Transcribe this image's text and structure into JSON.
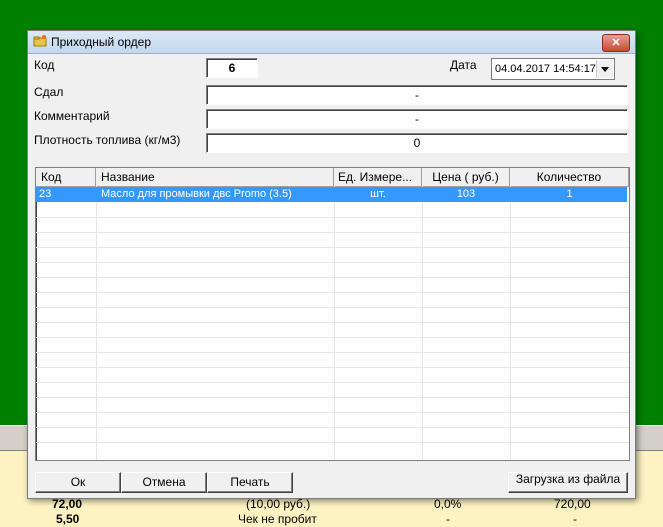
{
  "dialog": {
    "title": "Приходный ордер",
    "close_label": "✕"
  },
  "form": {
    "code_label": "Код",
    "code_value": "6",
    "date_label": "Дата",
    "date_value": "04.04.2017 14:54:17",
    "handed_label": "Сдал",
    "handed_value": "-",
    "comment_label": "Комментарий",
    "comment_value": "-",
    "density_label": "Плотность топлива (кг/м3)",
    "density_value": "0"
  },
  "table": {
    "columns": [
      "Код",
      "Название",
      "Ед. Измере...",
      "Цена ( руб.)",
      "Количество"
    ],
    "rows": [
      {
        "code": "23",
        "name": "Масло для промывки двс Promo (3.5)",
        "unit": "шт.",
        "price": "103",
        "qty": "1"
      }
    ]
  },
  "buttons": {
    "ok": "Ок",
    "cancel": "Отмена",
    "print": "Печать",
    "load": "Загрузка из файла"
  },
  "background": {
    "rows": [
      {
        "a": "72,00",
        "b": "(10,00 руб.)",
        "c": "0,0%",
        "d": "720,00"
      },
      {
        "a": "5,50",
        "b": "Чек не пробит",
        "c": "-",
        "d": "-"
      }
    ]
  },
  "colors": {
    "desktop": "#008000",
    "selection": "#3399ff"
  }
}
